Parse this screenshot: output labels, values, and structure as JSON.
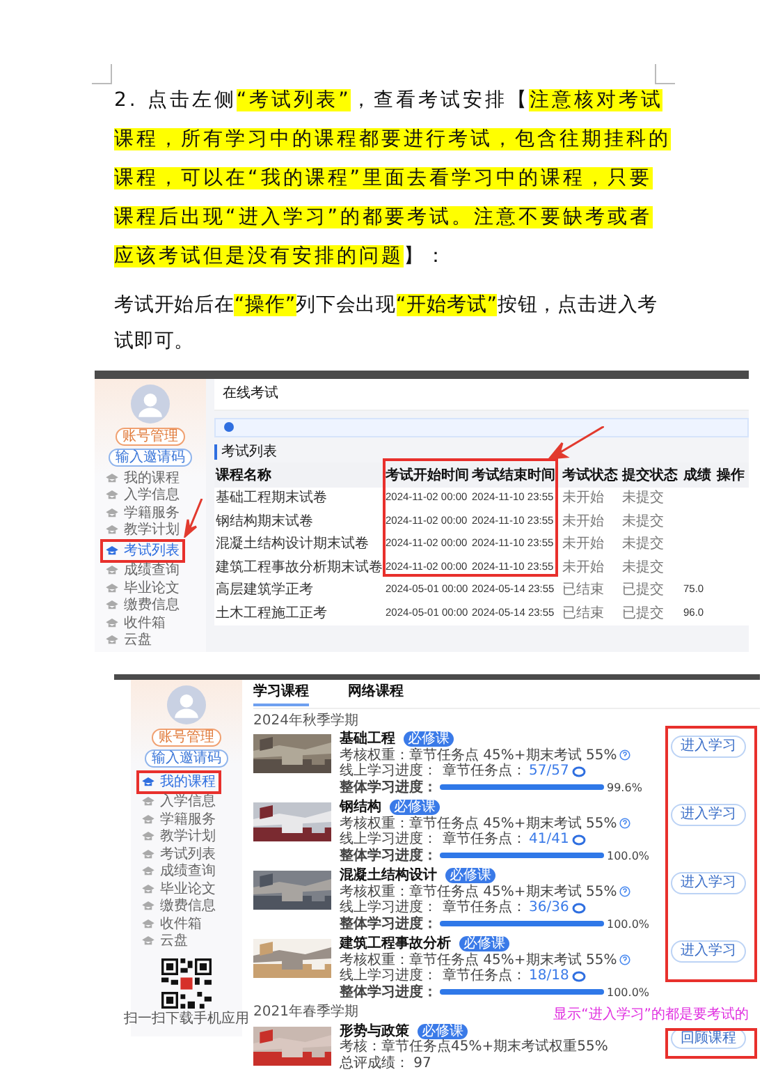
{
  "document": {
    "paragraphs": [
      {
        "segments": [
          {
            "text": "2. 点击左侧",
            "highlight": false
          },
          {
            "text": "“考试列表”",
            "highlight": true
          },
          {
            "text": "，查看考试安排【",
            "highlight": false
          },
          {
            "text": "注意核对考试课程，所有学习中的课程都要进行考试，包含往期挂科的课程，可以在“我的课程”里面去看学习中的课程，只要课程后出现“进入学习”的都要考试。注意不要缺考或者应该考试但是没有安排的问题",
            "highlight": true
          },
          {
            "text": "】：",
            "highlight": false
          }
        ]
      },
      {
        "segments": [
          {
            "text": "考试开始后在",
            "highlight": false
          },
          {
            "text": "“操作”",
            "highlight": true
          },
          {
            "text": "列下会出现",
            "highlight": false
          },
          {
            "text": "“开始考试”",
            "highlight": true
          },
          {
            "text": "按钮，点击进入考试即可。",
            "highlight": false
          }
        ]
      }
    ]
  },
  "exam_screenshot": {
    "sidebar": {
      "buttons": [
        "账号管理",
        "输入邀请码"
      ],
      "items": [
        {
          "label": "我的课程",
          "selected": false
        },
        {
          "label": "入学信息",
          "selected": false
        },
        {
          "label": "学籍服务",
          "selected": false
        },
        {
          "label": "教学计划",
          "selected": false
        },
        {
          "label": "考试列表",
          "selected": true
        },
        {
          "label": "成绩查询",
          "selected": false
        },
        {
          "label": "毕业论文",
          "selected": false
        },
        {
          "label": "缴费信息",
          "selected": false
        },
        {
          "label": "收件箱",
          "selected": false
        },
        {
          "label": "云盘",
          "selected": false
        }
      ]
    },
    "header": "在线考试",
    "section_title": "考试列表",
    "table": {
      "columns": [
        "课程名称",
        "考试开始时间",
        "考试结束时间",
        "考试状态",
        "提交状态",
        "成绩",
        "操作"
      ],
      "rows": [
        [
          "基础工程期末试卷",
          "2024-11-02 00:00",
          "2024-11-10 23:55",
          "未开始",
          "未提交",
          ""
        ],
        [
          "钢结构期末试卷",
          "2024-11-02 00:00",
          "2024-11-10 23:55",
          "未开始",
          "未提交",
          ""
        ],
        [
          "混凝土结构设计期末试卷",
          "2024-11-02 00:00",
          "2024-11-10 23:55",
          "未开始",
          "未提交",
          ""
        ],
        [
          "建筑工程事故分析期末试卷",
          "2024-11-02 00:00",
          "2024-11-10 23:55",
          "未开始",
          "未提交",
          ""
        ],
        [
          "高层建筑学正考",
          "2024-05-01 00:00",
          "2024-05-14 23:55",
          "已结束",
          "已提交",
          "75.0"
        ],
        [
          "土木工程施工正考",
          "2024-05-01 00:00",
          "2024-05-14 23:55",
          "已结束",
          "已提交",
          "96.0"
        ]
      ]
    }
  },
  "courses_screenshot": {
    "sidebar": {
      "buttons": [
        "账号管理",
        "输入邀请码"
      ],
      "items": [
        {
          "label": "我的课程",
          "selected": true
        },
        {
          "label": "入学信息",
          "selected": false
        },
        {
          "label": "学籍服务",
          "selected": false
        },
        {
          "label": "教学计划",
          "selected": false
        },
        {
          "label": "考试列表",
          "selected": false
        },
        {
          "label": "成绩查询",
          "selected": false
        },
        {
          "label": "毕业论文",
          "selected": false
        },
        {
          "label": "缴费信息",
          "selected": false
        },
        {
          "label": "收件箱",
          "selected": false
        },
        {
          "label": "云盘",
          "selected": false
        }
      ],
      "qr_caption": "扫一扫下载手机应用"
    },
    "tabs": [
      {
        "label": "学习课程",
        "selected": true
      },
      {
        "label": "网络课程",
        "selected": false
      }
    ],
    "terms": [
      {
        "title": "2024年秋季学期",
        "courses": [
          {
            "kind": "active",
            "title": "基础工程",
            "badge": "必修课",
            "weight": "考核权重：章节任务点 45%+期末考试 55%",
            "online_label": "线上学习进度：",
            "task_label": "章节任务点：",
            "task_count": "57/57",
            "overall_label": "整体学习进度：",
            "level": 0.996,
            "percent": "99.6%",
            "button": "进入学习"
          },
          {
            "kind": "active",
            "title": "钢结构",
            "badge": "必修课",
            "weight": "考核权重：章节任务点 45%+期末考试 55%",
            "online_label": "线上学习进度：",
            "task_label": "章节任务点：",
            "task_count": "41/41",
            "overall_label": "整体学习进度：",
            "level": 1,
            "percent": "100.0%",
            "button": "进入学习"
          },
          {
            "kind": "active",
            "title": "混凝土结构设计",
            "badge": "必修课",
            "weight": "考核权重：章节任务点 45%+期末考试 55%",
            "online_label": "线上学习进度：",
            "task_label": "章节任务点：",
            "task_count": "36/36",
            "overall_label": "整体学习进度：",
            "level": 1,
            "percent": "100.0%",
            "button": "进入学习"
          },
          {
            "kind": "active",
            "title": "建筑工程事故分析",
            "badge": "必修课",
            "weight": "考核权重：章节任务点 45%+期末考试 55%",
            "online_label": "线上学习进度：",
            "task_label": "章节任务点：",
            "task_count": "18/18",
            "overall_label": "整体学习进度：",
            "level": 1,
            "percent": "100.0%",
            "button": "进入学习"
          }
        ]
      },
      {
        "title": "2021年春季学期",
        "courses": [
          {
            "kind": "finished",
            "title": "形势与政策",
            "badge": "必修课",
            "weight": "考核：章节任务点45%+期末考试权重55%",
            "score": "总评成绩： 97",
            "button": "回顾课程"
          }
        ]
      }
    ],
    "note": "显示“进入学习”的都是要考试的"
  }
}
